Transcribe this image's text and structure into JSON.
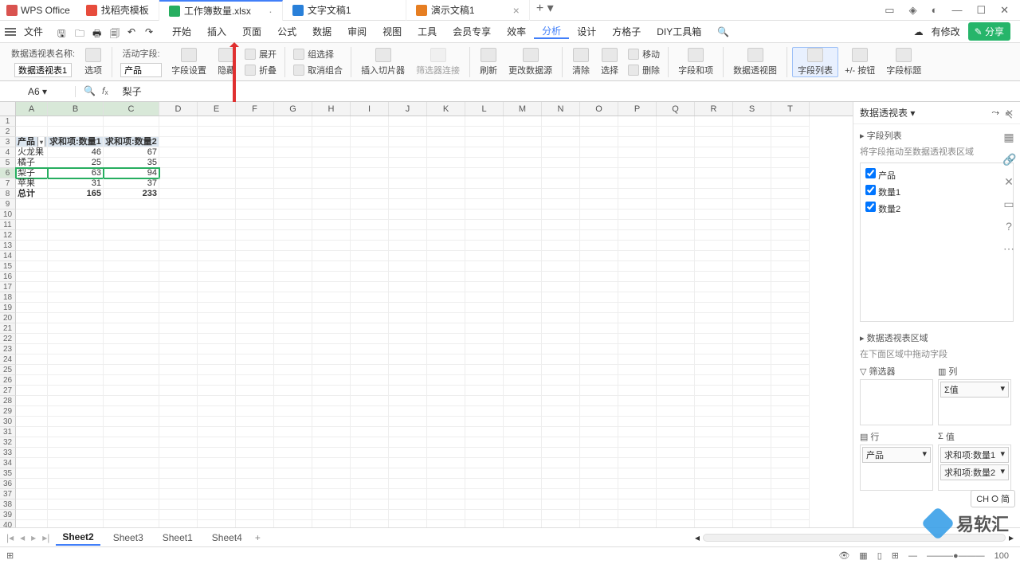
{
  "app": {
    "name": "WPS Office"
  },
  "tabs": [
    {
      "label": "找稻壳模板",
      "icon": "red"
    },
    {
      "label": "工作簿数量.xlsx",
      "icon": "green",
      "active": true
    },
    {
      "label": "文字文稿1",
      "icon": "blue"
    },
    {
      "label": "演示文稿1",
      "icon": "orange"
    }
  ],
  "menu": {
    "file": "文件",
    "items": [
      "开始",
      "插入",
      "页面",
      "公式",
      "数据",
      "审阅",
      "视图",
      "工具",
      "会员专享",
      "效率",
      "分析",
      "设计",
      "方格子",
      "DIY工具箱"
    ],
    "active": "分析",
    "right": {
      "modify": "有修改",
      "share": "分享"
    }
  },
  "ribbon": {
    "nameLabel": "数据透视表名称:",
    "nameValue": "数据透视表1",
    "options": "选项",
    "fieldLabel": "活动字段:",
    "fieldValue": "产品",
    "fieldSettings": "字段设置",
    "hide": "隐藏",
    "expand": "展开",
    "collapse": "折叠",
    "groupSel": "组选择",
    "ungroup": "取消组合",
    "insertSlicer": "插入切片器",
    "filterConn": "筛选器连接",
    "refresh": "刷新",
    "changeSrc": "更改数据源",
    "clear": "清除",
    "select": "选择",
    "move": "移动",
    "delete": "删除",
    "fieldsItems": "字段和项",
    "pivotChart": "数据透视图",
    "fieldList": "字段列表",
    "buttons": "+/- 按钮",
    "fieldHdr": "字段标题"
  },
  "formula": {
    "cell": "A6",
    "value": "梨子"
  },
  "cols": [
    "A",
    "B",
    "C",
    "D",
    "E",
    "F",
    "G",
    "H",
    "I",
    "J",
    "K",
    "L",
    "M",
    "N",
    "O",
    "P",
    "Q",
    "R",
    "S",
    "T"
  ],
  "table": {
    "headers": [
      "产品",
      "求和项:数量1",
      "求和项:数量2"
    ],
    "rows": [
      {
        "a": "火龙果",
        "b": "46",
        "c": "67"
      },
      {
        "a": "橘子",
        "b": "25",
        "c": "35"
      },
      {
        "a": "梨子",
        "b": "63",
        "c": "94",
        "selected": true
      },
      {
        "a": "苹果",
        "b": "31",
        "c": "37"
      }
    ],
    "total": {
      "a": "总计",
      "b": "165",
      "c": "233"
    }
  },
  "panel": {
    "title": "数据透视表",
    "fieldList": "字段列表",
    "hint": "将字段拖动至数据透视表区域",
    "fields": [
      "产品",
      "数量1",
      "数量2"
    ],
    "areasTitle": "数据透视表区域",
    "areasHint": "在下面区域中拖动字段",
    "filter": "筛选器",
    "col": "列",
    "colItems": [
      "Σ值"
    ],
    "row": "行",
    "rowItems": [
      "产品"
    ],
    "val": "值",
    "valItems": [
      "求和项:数量1",
      "求和项:数量2"
    ]
  },
  "sheets": [
    "Sheet2",
    "Sheet3",
    "Sheet1",
    "Sheet4"
  ],
  "activeSheet": "Sheet2",
  "status": {
    "zoom": "100"
  },
  "lang": "CH ⭘ 简",
  "watermark": "易软汇",
  "chart_data": {
    "type": "table",
    "title": "数据透视表1",
    "columns": [
      "产品",
      "求和项:数量1",
      "求和项:数量2"
    ],
    "rows": [
      [
        "火龙果",
        46,
        67
      ],
      [
        "橘子",
        25,
        35
      ],
      [
        "梨子",
        63,
        94
      ],
      [
        "苹果",
        31,
        37
      ],
      [
        "总计",
        165,
        233
      ]
    ]
  }
}
